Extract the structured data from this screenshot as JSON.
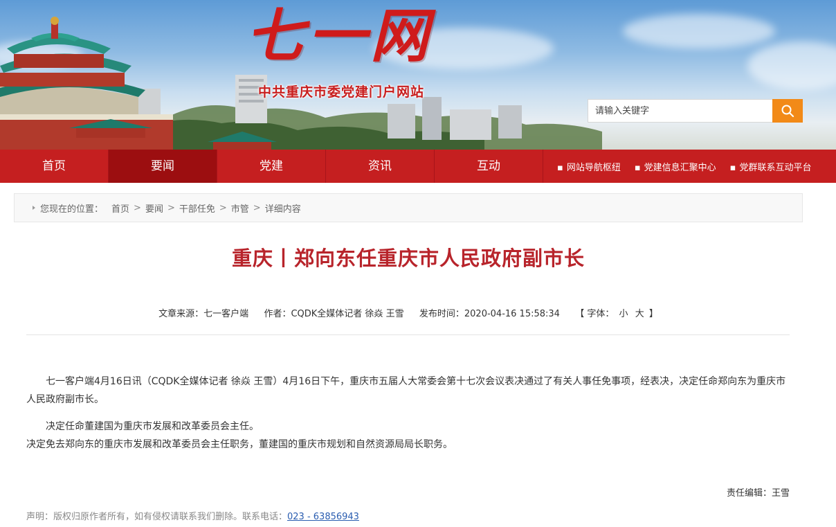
{
  "banner": {
    "logo": "七一网",
    "subtitle": "中共重庆市委党建门户网站",
    "search_placeholder": "请输入关键字"
  },
  "nav": {
    "items": [
      "首页",
      "要闻",
      "党建",
      "资讯",
      "互动"
    ],
    "active": "要闻",
    "links": [
      "网站导航枢纽",
      "党建信息汇聚中心",
      "党群联系互动平台"
    ]
  },
  "breadcrumb": {
    "label": "您现在的位置：",
    "items": [
      "首页",
      "要闻",
      "干部任免",
      "市管",
      "详细内容"
    ]
  },
  "article": {
    "title": "重庆丨郑向东任重庆市人民政府副市长",
    "meta": {
      "source_label": "文章来源：",
      "source": "七一客户端",
      "author_label": "作者：",
      "author": "CQDK全媒体记者 徐焱 王雪",
      "time_label": "发布时间：",
      "time": "2020-04-16 15:58:34",
      "font_open": "【",
      "font_label": "字体：",
      "font_small": "小",
      "font_large": "大",
      "font_close": "】"
    },
    "paragraphs": [
      "七一客户端4月16日讯（CQDK全媒体记者  徐焱  王雪）4月16日下午，重庆市五届人大常委会第十七次会议表决通过了有关人事任免事项，经表决，决定任命郑向东为重庆市人民政府副市长。",
      "决定任命董建国为重庆市发展和改革委员会主任。",
      "决定免去郑向东的重庆市发展和改革委员会主任职务，董建国的重庆市规划和自然资源局局长职务。"
    ],
    "editor_label": "责任编辑：",
    "editor": "王雪"
  },
  "footer": {
    "statement": "声明：版权归原作者所有，如有侵权请联系我们删除。联系电话：",
    "phone": "023 - 63856943"
  },
  "colors": {
    "nav_bg": "#c51f20",
    "nav_active": "#9c0e10",
    "title_red": "#b8242b",
    "search_btn": "#f28a18"
  }
}
